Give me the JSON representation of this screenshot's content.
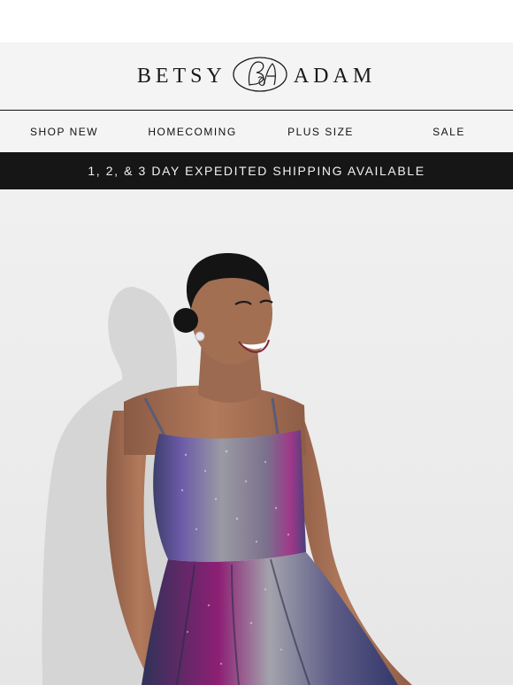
{
  "brand": {
    "name_left": "BETSY",
    "name_right": "ADAM",
    "monogram": "B&A",
    "colors": {
      "ink": "#1a1a1a",
      "bar": "#f4f4f4",
      "banner": "#161616"
    }
  },
  "nav": {
    "items": [
      {
        "label": "SHOP NEW"
      },
      {
        "label": "HOMECOMING"
      },
      {
        "label": "PLUS SIZE"
      },
      {
        "label": "SALE"
      }
    ]
  },
  "banner": {
    "text": "1, 2, & 3 DAY EXPEDITED SHIPPING AVAILABLE"
  },
  "hero": {
    "image": "model-in-metallic-glitter-dress"
  }
}
